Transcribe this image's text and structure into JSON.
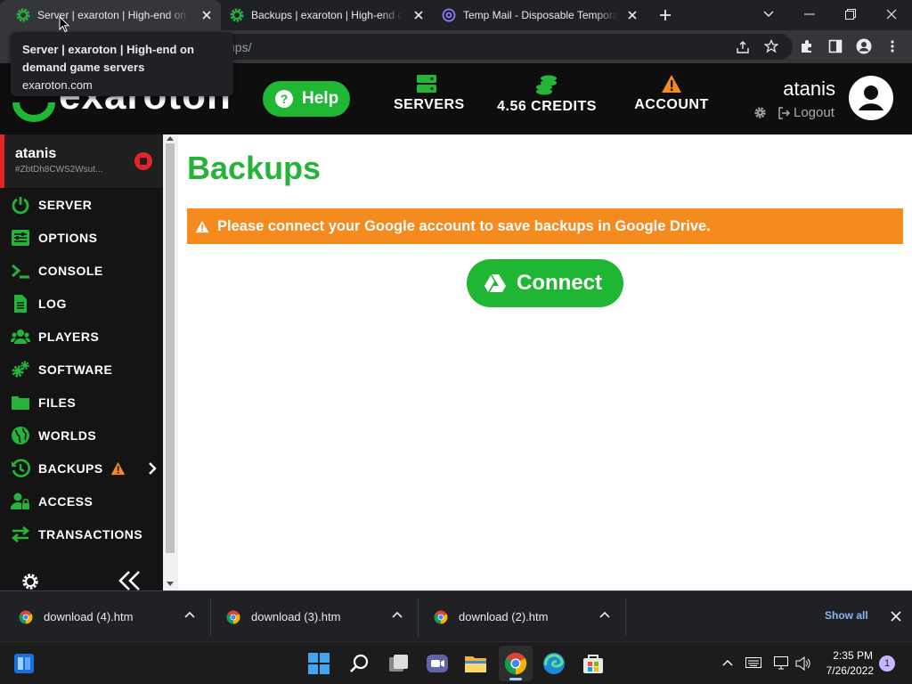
{
  "browser": {
    "tabs": [
      {
        "title": "Server | exaroton | High-end on demand game servers",
        "active": true
      },
      {
        "title": "Backups | exaroton | High-end on demand game servers",
        "active": false
      },
      {
        "title": "Temp Mail - Disposable Temporary Email",
        "active": false
      }
    ],
    "url_visible": "ups/",
    "tooltip": {
      "title": "Server | exaroton | High-end on demand game servers",
      "domain": "exaroton.com"
    }
  },
  "site": {
    "logo_text": "exaroton",
    "help_label": "Help",
    "nav": {
      "servers": "SERVERS",
      "credits": "4.56 CREDITS",
      "account": "ACCOUNT"
    },
    "user_name": "atanis",
    "logout_label": "Logout",
    "colors": {
      "brand_green": "#25b33a",
      "alert_orange": "#f58a1f",
      "stop_red": "#e52329"
    }
  },
  "sidebar": {
    "server_name": "atanis",
    "server_id": "#ZbtDh8CWS2Wsut...",
    "items": [
      {
        "label": "SERVER",
        "icon": "power-icon"
      },
      {
        "label": "OPTIONS",
        "icon": "sliders-icon"
      },
      {
        "label": "CONSOLE",
        "icon": "terminal-icon"
      },
      {
        "label": "LOG",
        "icon": "file-icon"
      },
      {
        "label": "PLAYERS",
        "icon": "users-icon"
      },
      {
        "label": "SOFTWARE",
        "icon": "cogs-icon"
      },
      {
        "label": "FILES",
        "icon": "folder-icon"
      },
      {
        "label": "WORLDS",
        "icon": "globe-icon"
      },
      {
        "label": "BACKUPS",
        "icon": "history-icon"
      },
      {
        "label": "ACCESS",
        "icon": "user-lock-icon"
      },
      {
        "label": "TRANSACTIONS",
        "icon": "exchange-icon"
      }
    ]
  },
  "main": {
    "title": "Backups",
    "alert": "Please connect your Google account to save backups in Google Drive.",
    "connect_label": "Connect"
  },
  "downloads": {
    "items": [
      "download (4).htm",
      "download (3).htm",
      "download (2).htm"
    ],
    "show_all": "Show all"
  },
  "taskbar": {
    "time": "2:35 PM",
    "date": "7/26/2022",
    "notifications": "1"
  }
}
